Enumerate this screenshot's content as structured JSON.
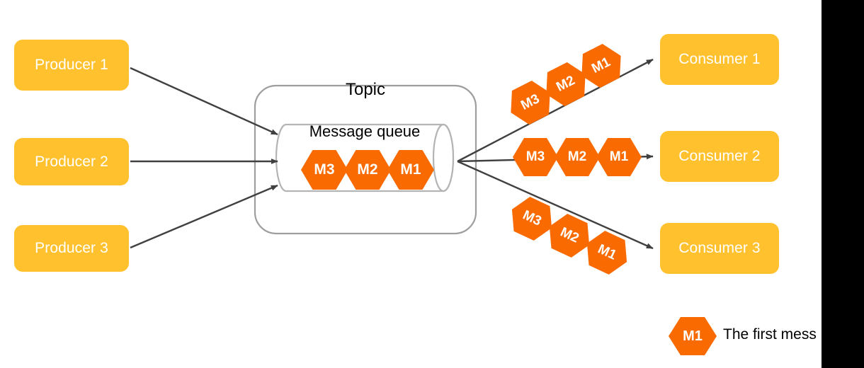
{
  "diagram": {
    "title": "Publish-subscribe topic with message queue fanning out to consumers",
    "colors": {
      "box_fill": "#FFC12E",
      "message_fill": "#F96A00",
      "box_text": "#FFFFFF",
      "arrow": "#404040",
      "container_border": "#9E9E9E",
      "background": "#FFFFFF",
      "crop_bar": "#000000"
    }
  },
  "producers": [
    {
      "label": "Producer 1"
    },
    {
      "label": "Producer 2"
    },
    {
      "label": "Producer 3"
    }
  ],
  "topic": {
    "label": "Topic",
    "queue": {
      "label": "Message queue",
      "messages": [
        {
          "label": "M3"
        },
        {
          "label": "M2"
        },
        {
          "label": "M1"
        }
      ]
    }
  },
  "consumers": [
    {
      "label": "Consumer 1",
      "messages": [
        {
          "label": "M3"
        },
        {
          "label": "M2"
        },
        {
          "label": "M1"
        }
      ]
    },
    {
      "label": "Consumer 2",
      "messages": [
        {
          "label": "M3"
        },
        {
          "label": "M2"
        },
        {
          "label": "M1"
        }
      ]
    },
    {
      "label": "Consumer 3",
      "messages": [
        {
          "label": "M3"
        },
        {
          "label": "M2"
        },
        {
          "label": "M1"
        }
      ]
    }
  ],
  "legend": {
    "marker": "M1",
    "text": "The first mess"
  }
}
